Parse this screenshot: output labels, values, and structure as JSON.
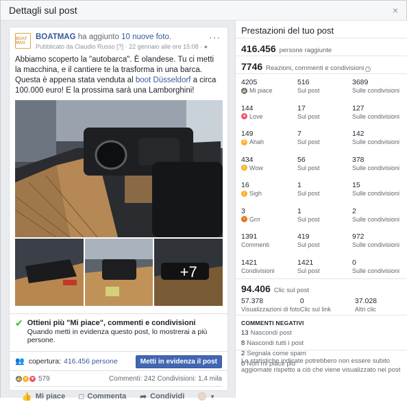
{
  "dialog": {
    "title": "Dettagli sul post",
    "close": "×"
  },
  "post": {
    "avatar_text": "BOAT MAG",
    "page_name": "BOATMAG",
    "added_text": "ha aggiunto",
    "photos_link": "10 nuove foto.",
    "published_by": "Pubblicato da Claudio Russo [?] · 22 gennaio alle ore 15:08 ·",
    "more": "···",
    "text_1": "Abbiamo scoperto la \"autobarca\". È olandese. Tu ci metti la macchina, e il cantiere te la trasforma in una barca. Questa è appena stata venduta al ",
    "text_link": "boot Düsseldorf",
    "text_2": " a circa 100.000 euro! E la prossima sarà una Lamborghini!",
    "more_photos": "+7",
    "tip_title": "Ottieni più \"Mi piace\", commenti e condivisioni",
    "tip_sub": "Quando metti in evidenza questo post, lo mostrerai a più persone.",
    "reach_label": "copertura:",
    "reach_value": "416.456 persone",
    "boost_button": "Metti in evidenza il post",
    "reactions_count": "579",
    "comments_shares": "Commenti: 242  Condivisioni: 1,4 mila",
    "actions": {
      "like": "Mi piace",
      "comment": "Commenta",
      "share": "Condividi"
    }
  },
  "performance": {
    "title": "Prestazioni del tuo post",
    "reach_num": "416.456",
    "reach_label": "persone raggiunte",
    "engagement_num": "7746",
    "engagement_label": "Reazioni, commenti e condivisioni",
    "rows": [
      {
        "a_num": "4205",
        "a_label": "Mi piace",
        "b_num": "516",
        "b_label": "Sul post",
        "c_num": "3689",
        "c_label": "Sulle condivisioni",
        "emoji": "like"
      },
      {
        "a_num": "144",
        "a_label": "Love",
        "b_num": "17",
        "b_label": "Sul post",
        "c_num": "127",
        "c_label": "Sulle condivisioni",
        "emoji": "love"
      },
      {
        "a_num": "149",
        "a_label": "Ahah",
        "b_num": "7",
        "b_label": "Sul post",
        "c_num": "142",
        "c_label": "Sulle condivisioni",
        "emoji": "haha"
      },
      {
        "a_num": "434",
        "a_label": "Wow",
        "b_num": "56",
        "b_label": "Sul post",
        "c_num": "378",
        "c_label": "Sulle condivisioni",
        "emoji": "wow"
      },
      {
        "a_num": "16",
        "a_label": "Sigh",
        "b_num": "1",
        "b_label": "Sul post",
        "c_num": "15",
        "c_label": "Sulle condivisioni",
        "emoji": "sad"
      },
      {
        "a_num": "3",
        "a_label": "Grrr",
        "b_num": "1",
        "b_label": "Sul post",
        "c_num": "2",
        "c_label": "Sulle condivisioni",
        "emoji": "angry"
      },
      {
        "a_num": "1391",
        "a_label": "Commenti",
        "b_num": "419",
        "b_label": "Sul post",
        "c_num": "972",
        "c_label": "Sulle condivisioni",
        "emoji": ""
      },
      {
        "a_num": "1421",
        "a_label": "Condivisioni",
        "b_num": "1421",
        "b_label": "Sul post",
        "c_num": "0",
        "c_label": "Sulle condivisioni",
        "emoji": ""
      }
    ],
    "clicks_num": "94.406",
    "clicks_label": "Clic sul post",
    "clicks": [
      {
        "num": "57.378",
        "label": "Visualizzazioni di foto"
      },
      {
        "num": "0",
        "label": "Clic sul link"
      },
      {
        "num": "37.028",
        "label": "Altri clic"
      }
    ],
    "negative_title": "COMMENTI NEGATIVI",
    "negative": [
      {
        "num": "13",
        "label": "Nascondi post"
      },
      {
        "num": "8",
        "label": "Nascondi tutti i post"
      },
      {
        "num": "2",
        "label": "Segnala come spam"
      },
      {
        "num": "0",
        "label": "Non mi piace più"
      }
    ],
    "disclaimer": "Le statistiche indicate potrebbero non essere subito aggiornate rispetto a ciò che viene visualizzato nei post"
  },
  "colors": {
    "brand_blue": "#4267b2",
    "link_blue": "#365899",
    "check_green": "#42b72a"
  }
}
